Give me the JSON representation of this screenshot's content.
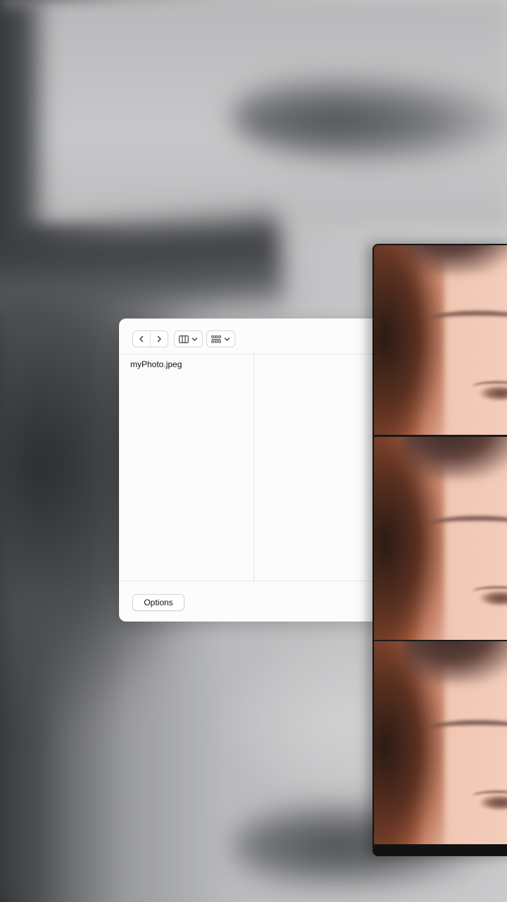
{
  "toolbar": {
    "back_icon": "‹",
    "forward_icon": "›",
    "view_icon": "columns-icon",
    "group_icon": "group-icon"
  },
  "files": [
    {
      "name": "myPhoto.jpeg"
    }
  ],
  "footer": {
    "options_label": "Options"
  }
}
